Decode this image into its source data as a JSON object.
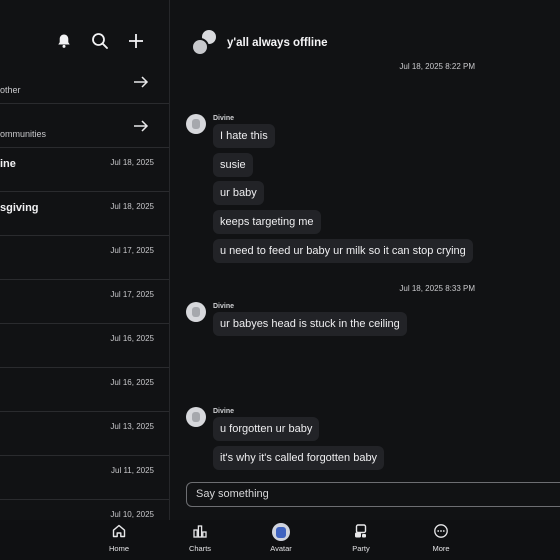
{
  "left": {
    "rows": [
      {
        "label": "other",
        "type": "link"
      },
      {
        "label": "ommunities",
        "type": "link"
      },
      {
        "title": "ine",
        "date": "Jul 18, 2025"
      },
      {
        "title": "sgiving",
        "date": "Jul 18, 2025"
      },
      {
        "title": "",
        "date": "Jul 17, 2025"
      },
      {
        "title": "",
        "date": "Jul 17, 2025"
      },
      {
        "title": "",
        "date": "Jul 16, 2025"
      },
      {
        "title": "",
        "date": "Jul 16, 2025"
      },
      {
        "title": "",
        "date": "Jul 13, 2025"
      },
      {
        "title": "",
        "date": "Jul 11, 2025"
      },
      {
        "title": "",
        "date": "Jul 10, 2025"
      }
    ]
  },
  "chat": {
    "title": "y'all always offline",
    "timestamps": [
      "Jul 18, 2025 8:22 PM",
      "Jul 18, 2025 8:33 PM"
    ],
    "groups": [
      {
        "sender": "Divine",
        "messages": [
          "I hate this",
          "susie",
          "ur baby",
          "keeps targeting me",
          "u need to feed ur baby ur milk so it can stop crying"
        ]
      },
      {
        "sender": "Divine",
        "messages": [
          "ur babyes head is stuck in the ceiling"
        ]
      },
      {
        "sender": "Divine",
        "messages": [
          "u forgotten ur baby",
          "it's why it's called forgotten baby"
        ]
      }
    ],
    "input_placeholder": "Say something"
  },
  "nav": {
    "items": [
      {
        "label": "Home",
        "icon": "home-icon"
      },
      {
        "label": "Charts",
        "icon": "charts-icon"
      },
      {
        "label": "Avatar",
        "icon": "avatar-icon"
      },
      {
        "label": "Party",
        "icon": "party-icon"
      },
      {
        "label": "More",
        "icon": "more-icon"
      }
    ]
  }
}
